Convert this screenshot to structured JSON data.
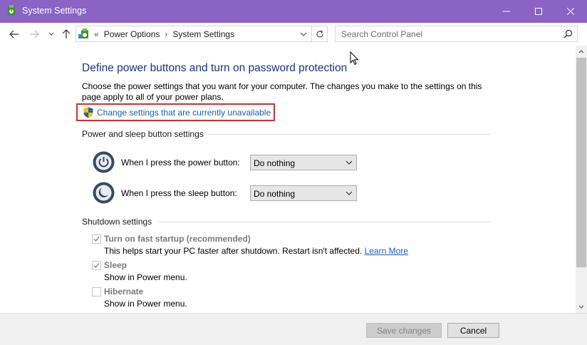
{
  "window": {
    "title": "System Settings",
    "accent_color": "#8a63c4"
  },
  "navbar": {
    "breadcrumb_prefix": "«",
    "crumbs": [
      "Power Options",
      "System Settings"
    ],
    "separator": "›",
    "search_placeholder": "Search Control Panel"
  },
  "page": {
    "title": "Define power buttons and turn on password protection",
    "description": "Choose the power settings that you want for your computer. The changes you make to the settings on this page apply to all of your power plans.",
    "change_link": "Change settings that are currently unavailable"
  },
  "power_section": {
    "heading": "Power and sleep button settings",
    "power_label": "When I press the power button:",
    "power_value": "Do nothing",
    "sleep_label": "When I press the sleep button:",
    "sleep_value": "Do nothing"
  },
  "shutdown_section": {
    "heading": "Shutdown settings",
    "items": [
      {
        "label": "Turn on fast startup (recommended)",
        "desc": "This helps start your PC faster after shutdown. Restart isn't affected.",
        "link": "Learn More",
        "checked": true
      },
      {
        "label": "Sleep",
        "desc": "Show in Power menu.",
        "checked": true
      },
      {
        "label": "Hibernate",
        "desc": "Show in Power menu.",
        "checked": false
      }
    ]
  },
  "footer": {
    "save_label": "Save changes",
    "cancel_label": "Cancel"
  }
}
